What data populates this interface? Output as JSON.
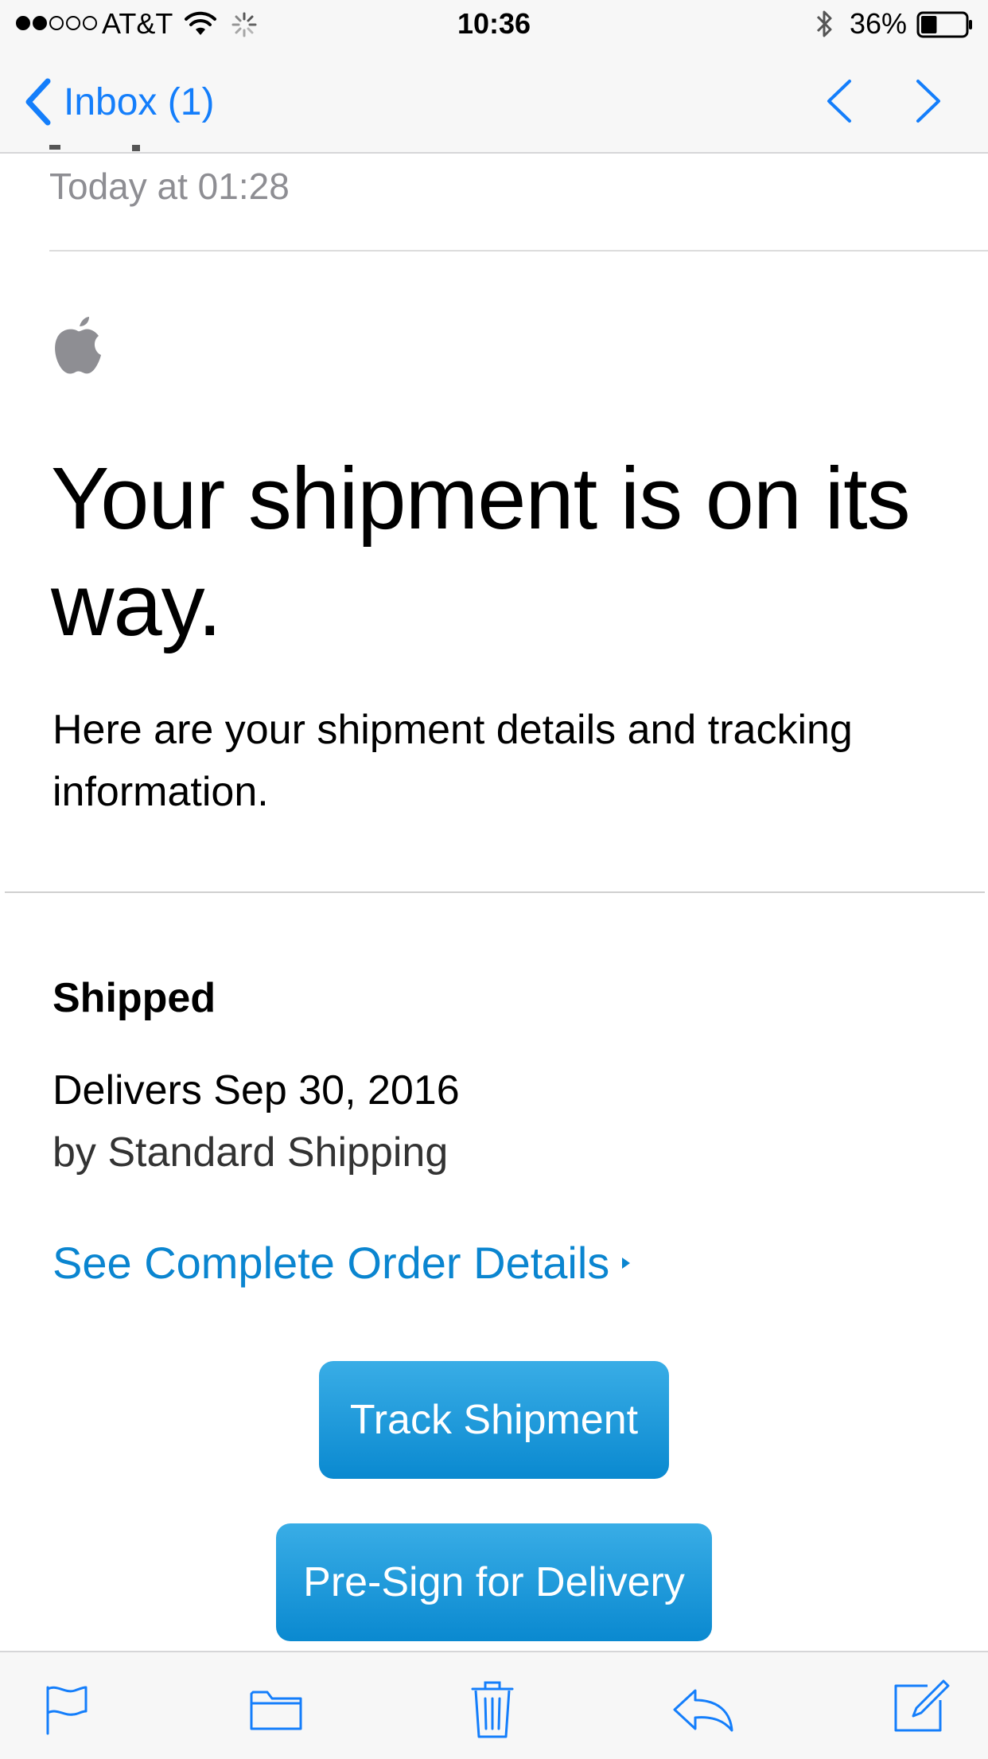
{
  "status_bar": {
    "carrier": "AT&T",
    "time": "10:36",
    "battery_percent": "36%",
    "battery_level": 0.36,
    "signal_bars_filled": 2,
    "signal_bars_total": 5
  },
  "nav": {
    "back_label": "Inbox (1)",
    "accent_color": "#147efb"
  },
  "email": {
    "date": "Today at 01:28",
    "headline": "Your shipment is on its way.",
    "intro": "Here are your shipment details and tracking information.",
    "status_heading": "Shipped",
    "delivery": "Delivers Sep 30, 2016",
    "shipping_method": "by Standard Shipping",
    "order_link": "See Complete Order Details",
    "buttons": {
      "track": "Track Shipment",
      "presign": "Pre-Sign for Delivery"
    },
    "button_color": "#1a96d9",
    "link_color": "#0a85d0"
  },
  "toolbar": {
    "icons": [
      "flag-icon",
      "folder-icon",
      "trash-icon",
      "reply-icon",
      "compose-icon"
    ]
  }
}
